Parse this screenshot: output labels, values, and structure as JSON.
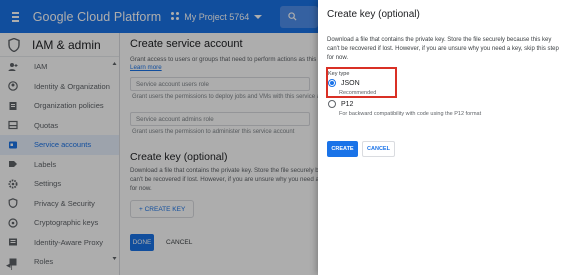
{
  "topbar": {
    "brand": "Google Cloud Platform",
    "project": "My Project 5764"
  },
  "sidebar": {
    "title": "IAM & admin",
    "items": [
      {
        "label": "IAM",
        "icon": "person-add-icon"
      },
      {
        "label": "Identity & Organization",
        "icon": "account-circle-icon"
      },
      {
        "label": "Organization policies",
        "icon": "policy-doc-icon"
      },
      {
        "label": "Quotas",
        "icon": "quotas-icon"
      },
      {
        "label": "Service accounts",
        "icon": "service-accounts-icon"
      },
      {
        "label": "Labels",
        "icon": "label-icon"
      },
      {
        "label": "Settings",
        "icon": "settings-icon"
      },
      {
        "label": "Privacy & Security",
        "icon": "shield-icon"
      },
      {
        "label": "Cryptographic keys",
        "icon": "key-icon"
      },
      {
        "label": "Identity-Aware Proxy",
        "icon": "proxy-icon"
      },
      {
        "label": "Roles",
        "icon": "roles-icon"
      }
    ],
    "collapse": "◂|"
  },
  "main": {
    "title": "Create service account",
    "desc_line1": "Grant access to users or groups that need to perform actions as this servi",
    "learn_more": "Learn more",
    "field1_placeholder": "Service account users role",
    "field1_hint": "Grant users the permissions to deploy jobs and VMs with this service account",
    "field2_placeholder": "Service account admins role",
    "field2_hint": "Grant users the permission to administer this service account",
    "create_key_title": "Create key (optional)",
    "create_key_desc1": "Download a file that contains the private key. Store the file securely beca",
    "create_key_desc2": "can't be recovered if lost. However, if you are unsure why you need a key, s",
    "create_key_desc3": "for now.",
    "create_key_button": "+ CREATE KEY",
    "done": "DONE",
    "cancel": "CANCEL"
  },
  "panel": {
    "title": "Create key (optional)",
    "desc1": "Download a file that contains the private key. Store the file securely because this key",
    "desc2": "can't be recovered if lost. However, if you are unsure why you need a key, skip this step",
    "desc3": "for now.",
    "key_type_label": "Key type",
    "json_label": "JSON",
    "json_sub": "Recommended",
    "p12_label": "P12",
    "p12_sub": "For backward compatibility with code using the P12 format",
    "create": "CREATE",
    "cancel": "CANCEL"
  },
  "colors": {
    "brand_blue": "#1a73e8",
    "highlight_red": "#d93025"
  }
}
